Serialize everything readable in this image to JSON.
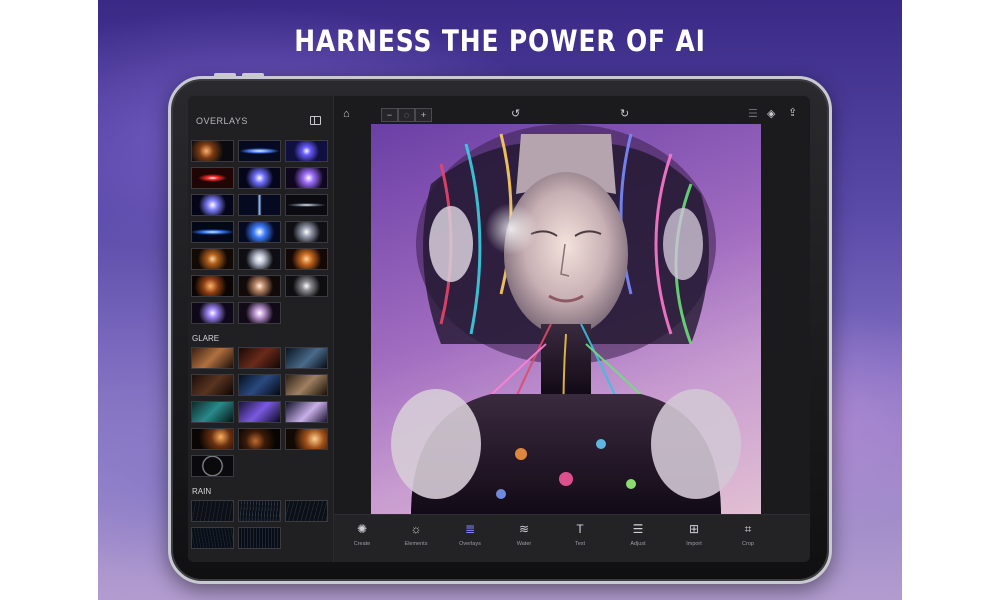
{
  "headline": "HARNESS THE POWER OF AI",
  "panel": {
    "title": "OVERLAYS",
    "sections": [
      {
        "label": "GLARE"
      },
      {
        "label": "RAIN"
      }
    ]
  },
  "toolbar": {
    "home_icon": "home-icon",
    "zoom": [
      "zoom-out-icon",
      "zoom-fit-icon",
      "zoom-in-icon"
    ],
    "undo_icon": "undo-icon",
    "redo_icon": "redo-icon",
    "list_icon": "list-icon",
    "layers_icon": "layers-icon",
    "share_icon": "share-icon"
  },
  "tools": [
    {
      "label": "Create",
      "icon": "sparkle-icon",
      "glyph": "✺"
    },
    {
      "label": "Elements",
      "icon": "sun-icon",
      "glyph": "☼"
    },
    {
      "label": "Overlays",
      "icon": "overlays-icon",
      "glyph": "≣"
    },
    {
      "label": "Water",
      "icon": "water-icon",
      "glyph": "≋"
    },
    {
      "label": "Text",
      "icon": "text-icon",
      "glyph": "T"
    },
    {
      "label": "Adjust",
      "icon": "sliders-icon",
      "glyph": "☰"
    },
    {
      "label": "Import",
      "icon": "import-icon",
      "glyph": "⊞"
    },
    {
      "label": "Crop",
      "icon": "crop-icon",
      "glyph": "⌗"
    }
  ],
  "active_tool": "Overlays",
  "colors": {
    "accent": "#7f89ff",
    "panel": "#202022",
    "screen": "#1b1b1d"
  }
}
